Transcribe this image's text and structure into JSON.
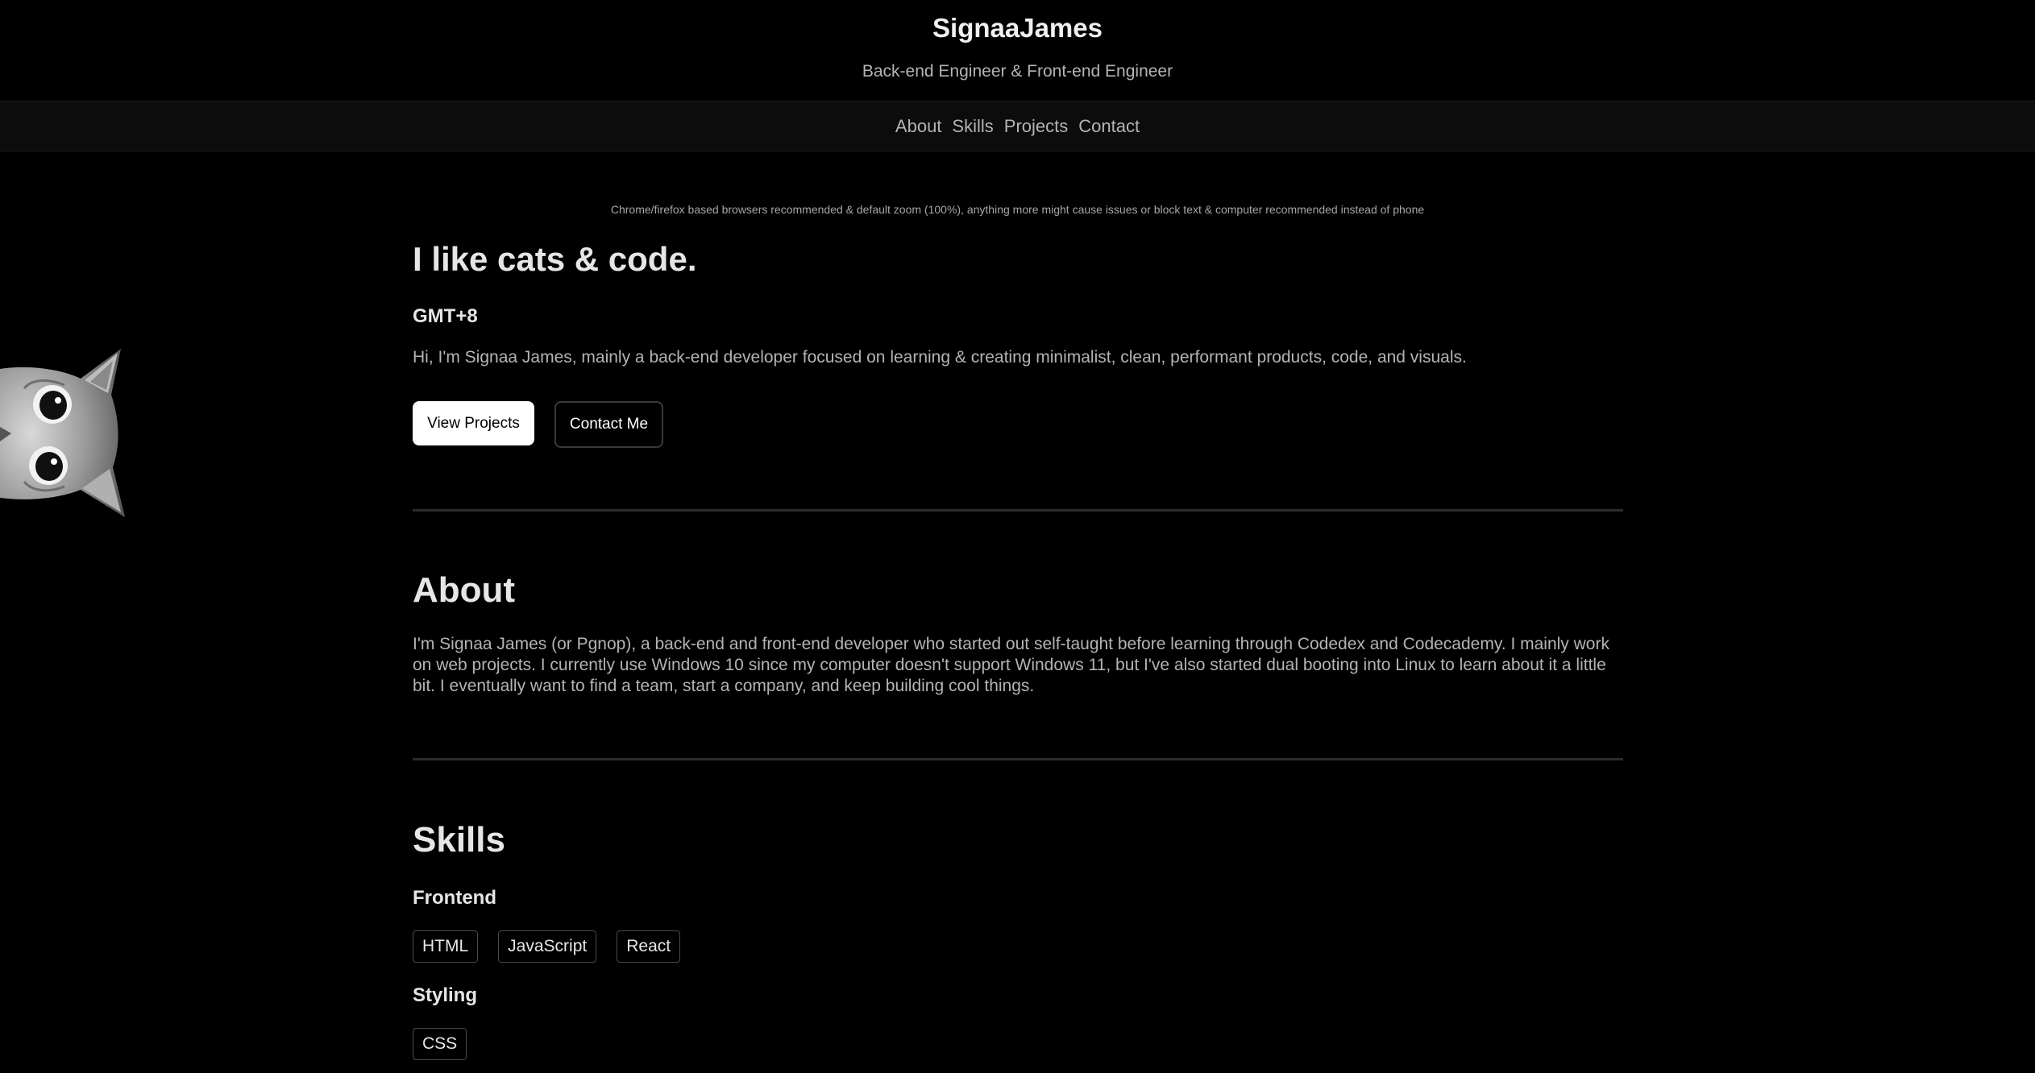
{
  "header": {
    "title": "SignaaJames",
    "subtitle": "Back-end Engineer & Front-end Engineer"
  },
  "nav": {
    "items": [
      {
        "label": "About"
      },
      {
        "label": "Skills"
      },
      {
        "label": "Projects"
      },
      {
        "label": "Contact"
      }
    ]
  },
  "browser_note": "Chrome/firefox based browsers recommended & default zoom (100%), anything more might cause issues or block text & computer recommended instead of phone",
  "hero": {
    "heading": "I like cats & code.",
    "timezone": "GMT+8",
    "intro": "Hi, I'm Signaa James, mainly a back-end developer focused on learning & creating minimalist, clean, performant products, code, and visuals.",
    "primary_button": "View Projects",
    "secondary_button": "Contact Me"
  },
  "about": {
    "heading": "About",
    "text": "I'm Signaa James (or Pgnop), a back-end and front-end developer who started out self-taught before learning through Codedex and Codecademy. I mainly work on web projects. I currently use Windows 10 since my computer doesn't support Windows 11, but I've also started dual booting into Linux to learn about it a little bit. I eventually want to find a team, start a company, and keep building cool things."
  },
  "skills": {
    "heading": "Skills",
    "groups": [
      {
        "title": "Frontend",
        "tags": [
          "HTML",
          "JavaScript",
          "React"
        ]
      },
      {
        "title": "Styling",
        "tags": [
          "CSS"
        ]
      }
    ]
  },
  "decoration": {
    "cat_icon": "peeking-cat-icon"
  }
}
